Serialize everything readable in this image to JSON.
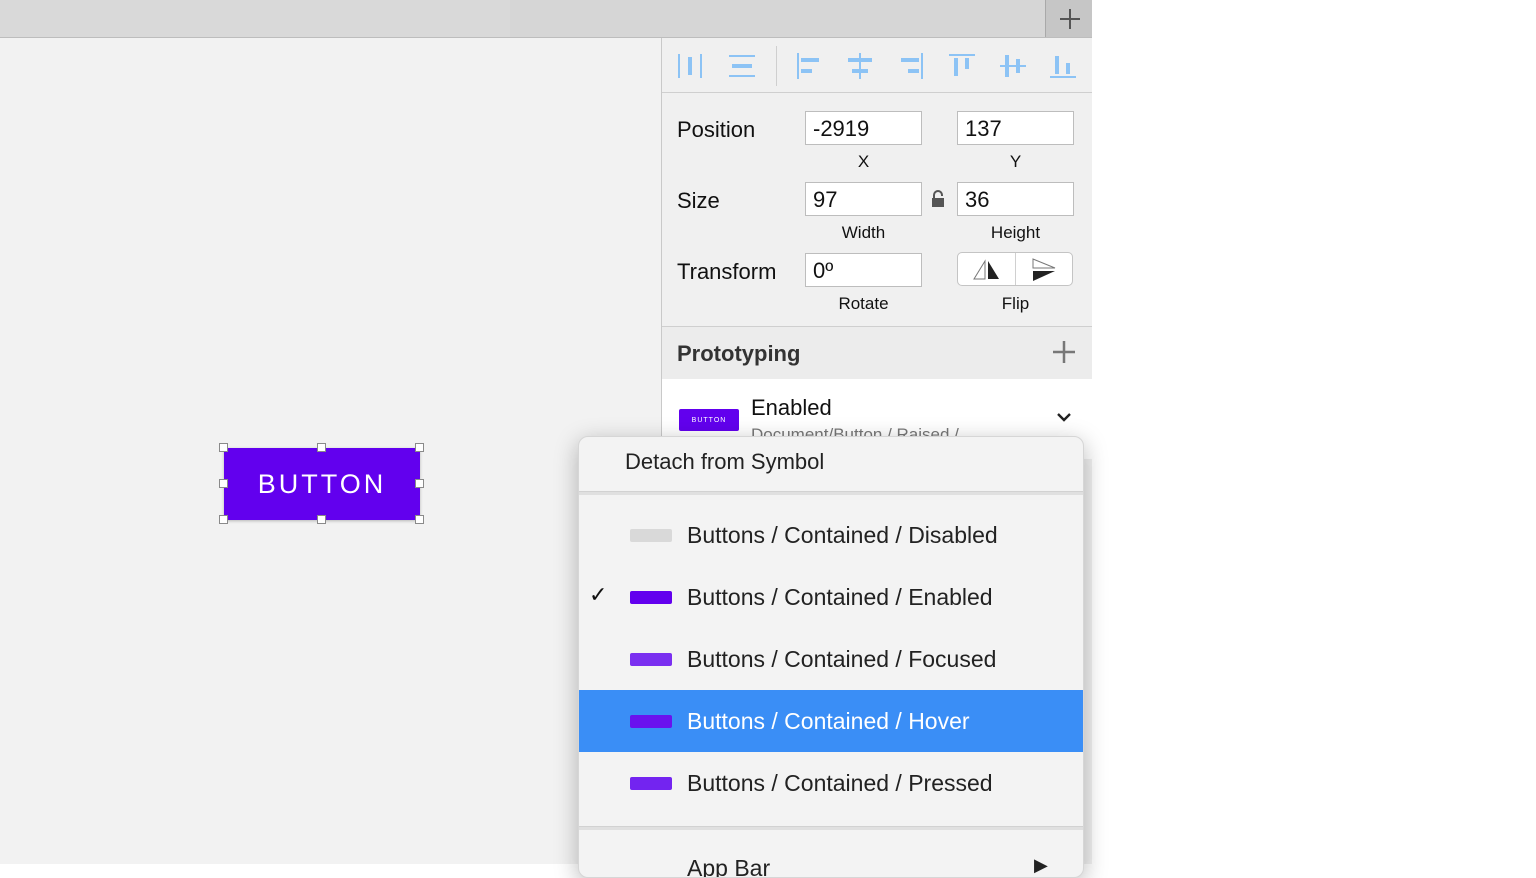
{
  "inspector": {
    "position": {
      "label": "Position",
      "x_value": "-2919",
      "y_value": "137",
      "x_sub": "X",
      "y_sub": "Y"
    },
    "size": {
      "label": "Size",
      "width_value": "97",
      "height_value": "36",
      "width_sub": "Width",
      "height_sub": "Height"
    },
    "transform": {
      "label": "Transform",
      "rotate_value": "0º",
      "rotate_sub": "Rotate",
      "flip_sub": "Flip"
    },
    "prototyping": {
      "title": "Prototyping"
    },
    "symbol": {
      "name": "Enabled",
      "path": "Document/Button / Raised /",
      "thumb_text": "BUTTON"
    }
  },
  "canvas": {
    "button_text": "BUTTON"
  },
  "menu": {
    "detach_label": "Detach from Symbol",
    "items": [
      {
        "label": "Buttons / Contained / Disabled",
        "checked": false,
        "color": "#d9d9d9"
      },
      {
        "label": "Buttons / Contained / Enabled",
        "checked": true,
        "check": "✓",
        "color": "#6200ee"
      },
      {
        "label": "Buttons / Contained / Focused",
        "checked": false,
        "color": "#7a2ff0"
      },
      {
        "label": "Buttons / Contained / Hover",
        "checked": false,
        "color": "#6a12ee",
        "highlighted": true
      },
      {
        "label": "Buttons / Contained / Pressed",
        "checked": false,
        "color": "#7324f0"
      }
    ],
    "partial_item_label": "App Bar"
  },
  "colors": {
    "accent": "#3a8ef6",
    "primary": "#6200ee",
    "align_icon": "#8cc3f5"
  }
}
